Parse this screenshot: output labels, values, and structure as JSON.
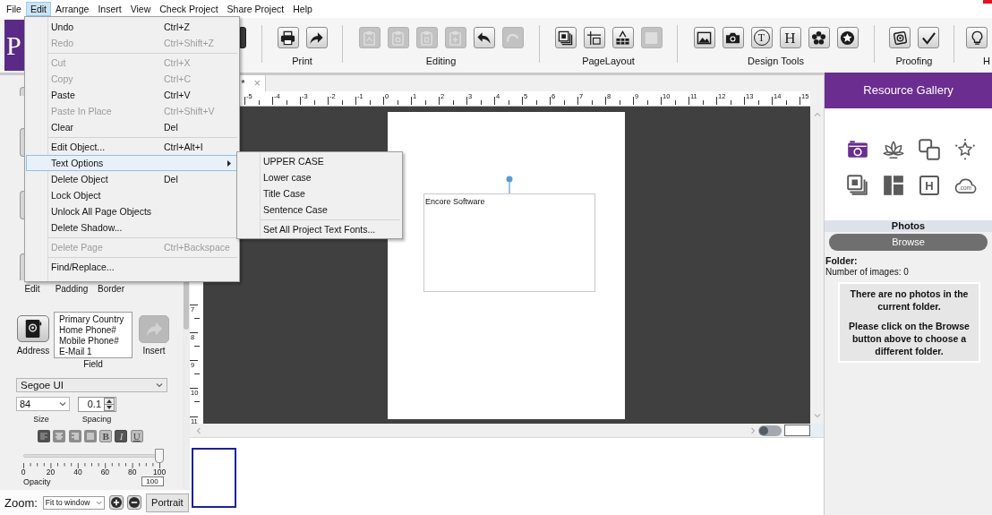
{
  "menu_bar": {
    "items": [
      {
        "label": "File",
        "selected": false
      },
      {
        "label": "Edit",
        "selected": true
      },
      {
        "label": "Arrange",
        "selected": false
      },
      {
        "label": "Insert",
        "selected": false
      },
      {
        "label": "View",
        "selected": false
      },
      {
        "label": "Check Project",
        "selected": false
      },
      {
        "label": "Share Project",
        "selected": false
      },
      {
        "label": "Help",
        "selected": false
      }
    ]
  },
  "toolbar": {
    "logo": "P",
    "groups": [
      {
        "label": "Print",
        "buttons": [
          {
            "disabled": false
          },
          {
            "disabled": false
          }
        ]
      },
      {
        "label": "Editing",
        "buttons": [
          {
            "disabled": true
          },
          {
            "disabled": true
          },
          {
            "disabled": true
          },
          {
            "disabled": true
          },
          {
            "disabled": false
          },
          {
            "disabled": true
          }
        ]
      },
      {
        "label": "PageLayout",
        "buttons": [
          {
            "disabled": false
          },
          {
            "disabled": false
          },
          {
            "disabled": false
          },
          {
            "disabled": true
          }
        ]
      },
      {
        "label": "Design Tools",
        "buttons": [
          {
            "disabled": false
          },
          {
            "disabled": false
          },
          {
            "disabled": false,
            "glyph": "T"
          },
          {
            "disabled": false,
            "glyph": "H"
          },
          {
            "disabled": false
          },
          {
            "disabled": false
          }
        ]
      },
      {
        "label": "Proofing",
        "buttons": [
          {
            "disabled": false
          },
          {
            "disabled": false
          }
        ]
      },
      {
        "label": "H",
        "buttons": [
          {
            "disabled": false
          }
        ]
      }
    ]
  },
  "edit_menu": {
    "sections": [
      [
        {
          "label": "Undo",
          "shortcut": "Ctrl+Z",
          "disabled": false,
          "selected": false,
          "submenu": false
        },
        {
          "label": "Redo",
          "shortcut": "Ctrl+Shift+Z",
          "disabled": true,
          "selected": false,
          "submenu": false
        }
      ],
      [
        {
          "label": "Cut",
          "shortcut": "Ctrl+X",
          "disabled": true,
          "selected": false,
          "submenu": false
        },
        {
          "label": "Copy",
          "shortcut": "Ctrl+C",
          "disabled": true,
          "selected": false,
          "submenu": false
        },
        {
          "label": "Paste",
          "shortcut": "Ctrl+V",
          "disabled": false,
          "selected": false,
          "submenu": false
        },
        {
          "label": "Paste In Place",
          "shortcut": "Ctrl+Shift+V",
          "disabled": true,
          "selected": false,
          "submenu": false
        },
        {
          "label": "Clear",
          "shortcut": "Del",
          "disabled": false,
          "selected": false,
          "submenu": false
        }
      ],
      [
        {
          "label": "Edit Object...",
          "shortcut": "Ctrl+Alt+I",
          "disabled": false,
          "selected": false,
          "submenu": false
        },
        {
          "label": "Text Options",
          "disabled": false,
          "selected": true,
          "submenu": true
        },
        {
          "label": "Delete Object",
          "shortcut": "Del",
          "disabled": false,
          "selected": false,
          "submenu": false
        },
        {
          "label": "Lock Object",
          "disabled": false,
          "selected": false,
          "submenu": false
        },
        {
          "label": "Unlock All Page Objects",
          "disabled": false,
          "selected": false,
          "submenu": false
        },
        {
          "label": "Delete Shadow...",
          "disabled": false,
          "selected": false,
          "submenu": false
        }
      ],
      [
        {
          "label": "Delete Page",
          "shortcut": "Ctrl+Backspace",
          "disabled": true,
          "selected": false,
          "submenu": false
        }
      ],
      [
        {
          "label": "Find/Replace...",
          "disabled": false,
          "selected": false,
          "submenu": false
        }
      ]
    ]
  },
  "text_options_submenu": {
    "sections": [
      [
        {
          "label": "UPPER CASE",
          "selected": false
        },
        {
          "label": "Lower case",
          "selected": false
        },
        {
          "label": "Title Case",
          "selected": false
        },
        {
          "label": "Sentence Case",
          "selected": false
        }
      ],
      [
        {
          "label": "Set All Project Text Fonts...",
          "selected": false
        }
      ]
    ]
  },
  "left_panel": {
    "tool_labels": [
      "Edit",
      "Padding",
      "Border"
    ],
    "address_button": "Address",
    "field_list": {
      "items": [
        "Primary Country",
        "Home Phone#",
        "Mobile Phone#",
        "E-Mail 1"
      ],
      "label": "Field"
    },
    "insert_button": {
      "label": "Insert",
      "disabled": true
    },
    "font": "Segoe UI",
    "size": {
      "value": "84",
      "label": "Size"
    },
    "spacing": {
      "value": "0.1",
      "label": "Spacing"
    },
    "align_buttons": [
      {
        "selected": true
      },
      {
        "selected": false
      },
      {
        "selected": false
      },
      {
        "selected": false
      }
    ],
    "style_buttons": [
      {
        "glyph": "B",
        "selected": false
      },
      {
        "glyph": "I",
        "selected": true
      },
      {
        "glyph": "U",
        "selected": false
      }
    ],
    "opacity": {
      "level": 1,
      "ticks": [
        "0",
        "20",
        "40",
        "60",
        "80",
        "100"
      ],
      "label": "Opacity",
      "value": "100"
    }
  },
  "zoom_bar": {
    "label": "Zoom:",
    "zoom": "Fit to window",
    "orientation_button": "Portrait"
  },
  "document_tab": {
    "label": "*",
    "close": "×",
    "selected": true
  },
  "rulers": {
    "horizontal": [
      "-5",
      "-4",
      "-3",
      "-2",
      "-1",
      "0",
      "1",
      "2",
      "3",
      "4",
      "5",
      "6",
      "7",
      "8",
      "9",
      "10",
      "11",
      "12",
      "13",
      "14",
      "15"
    ],
    "vertical": [
      "7",
      "8",
      "9",
      "10",
      "11"
    ]
  },
  "page": {
    "text_frame": {
      "text": "Encore Software",
      "selected": true
    }
  },
  "view_toggle": {
    "on": false
  },
  "page_thumbnails": [
    {
      "selected": true
    }
  ],
  "resource_gallery": {
    "title": "Resource Gallery",
    "icons": [
      {
        "selected": true
      },
      {
        "selected": false
      },
      {
        "selected": false
      },
      {
        "selected": false
      },
      {
        "selected": false
      },
      {
        "selected": false
      },
      {
        "selected": false,
        "glyph": "H"
      },
      {
        "selected": false,
        "glyph": ".com"
      }
    ],
    "section": "Photos",
    "browse_button": "Browse",
    "folder_label": "Folder:",
    "image_count": "Number of images: 0",
    "messages": [
      "There are no photos in the current folder.",
      "Please click on the Browse button above to choose a different folder."
    ]
  }
}
